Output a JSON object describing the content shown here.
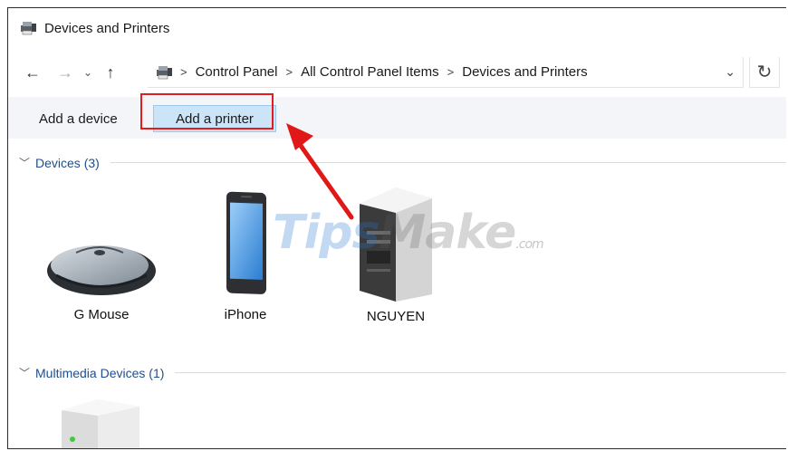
{
  "window": {
    "title": "Devices and Printers",
    "title_icon": "devices-printers-icon"
  },
  "address_bar": {
    "back_icon": "arrow-left-icon",
    "forward_icon": "arrow-right-icon",
    "recent_icon": "chevron-down-icon",
    "up_icon": "arrow-up-icon",
    "breadcrumb": [
      "Control Panel",
      "All Control Panel Items",
      "Devices and Printers"
    ],
    "refresh_icon": "refresh-icon"
  },
  "command_bar": {
    "add_device_label": "Add a device",
    "add_printer_label": "Add a printer"
  },
  "groups": [
    {
      "title": "Devices (3)",
      "items": [
        {
          "label": "G Mouse",
          "icon": "mouse-icon"
        },
        {
          "label": "iPhone",
          "icon": "phone-icon"
        },
        {
          "label": "NGUYEN",
          "icon": "computer-tower-icon"
        }
      ]
    },
    {
      "title": "Multimedia Devices (1)",
      "items": [
        {
          "label": "",
          "icon": "media-server-icon"
        }
      ]
    }
  ],
  "watermark": {
    "part1": "Tips",
    "part2": "Make",
    "part3": ".com"
  },
  "colors": {
    "accent": "#cce4f7",
    "highlight": "#e51c1c",
    "group_text": "#1e4e8c"
  }
}
